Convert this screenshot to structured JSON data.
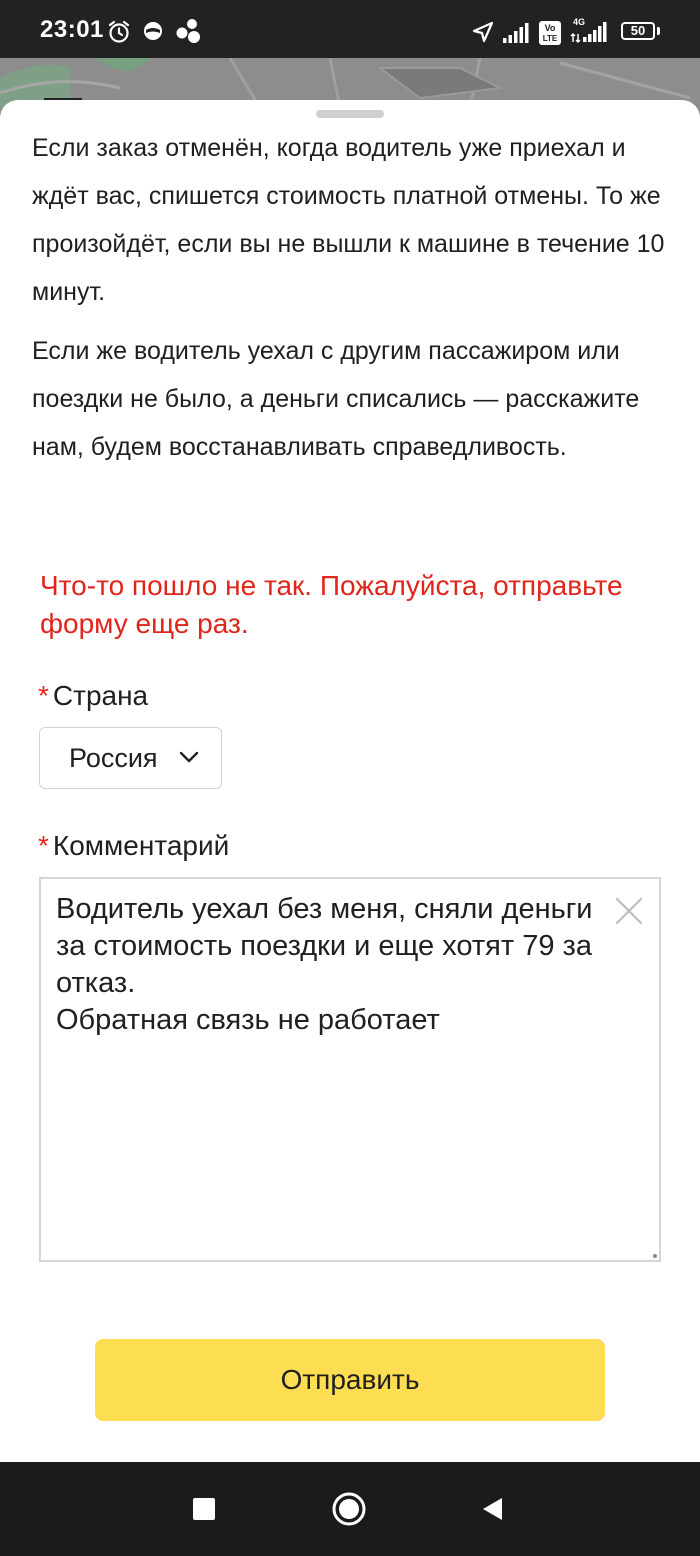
{
  "status_bar": {
    "time": "23:01",
    "battery": "50",
    "icons": [
      "alarm-icon",
      "app-notification-icon",
      "dots-cluster-icon",
      "location-arrow-icon",
      "signal-icon",
      "volte-icon",
      "signal-4g-icon",
      "battery-icon"
    ]
  },
  "info": {
    "paragraph_1": "Если заказ отменён, когда водитель уже приехал и ждёт вас, спишется стоимость платной отмены. То же произойдёт, если вы не вышли к машине в течение 10 минут.",
    "paragraph_2": "Если же водитель уехал с другим пассажиром или поездки не было, а деньги списались — расскажите нам, будем восстанавливать справедливость."
  },
  "form": {
    "error_message": "Что-то пошло не так. Пожалуйста, отправьте форму еще раз.",
    "required_mark": "*",
    "country_label": "Страна",
    "country_value": "Россия",
    "comment_label": "Комментарий",
    "comment_value": "Водитель уехал без меня, сняли деньги за стоимость поездки и еще хотят 79 за отказ.\nОбратная связь не работает",
    "submit_label": "Отправить"
  },
  "nav_bar": {
    "buttons": [
      "recent-apps-icon",
      "home-icon",
      "back-icon"
    ]
  },
  "colors": {
    "accent_yellow": "#fddd51",
    "error_red": "#e1251b",
    "text": "#21201f"
  }
}
